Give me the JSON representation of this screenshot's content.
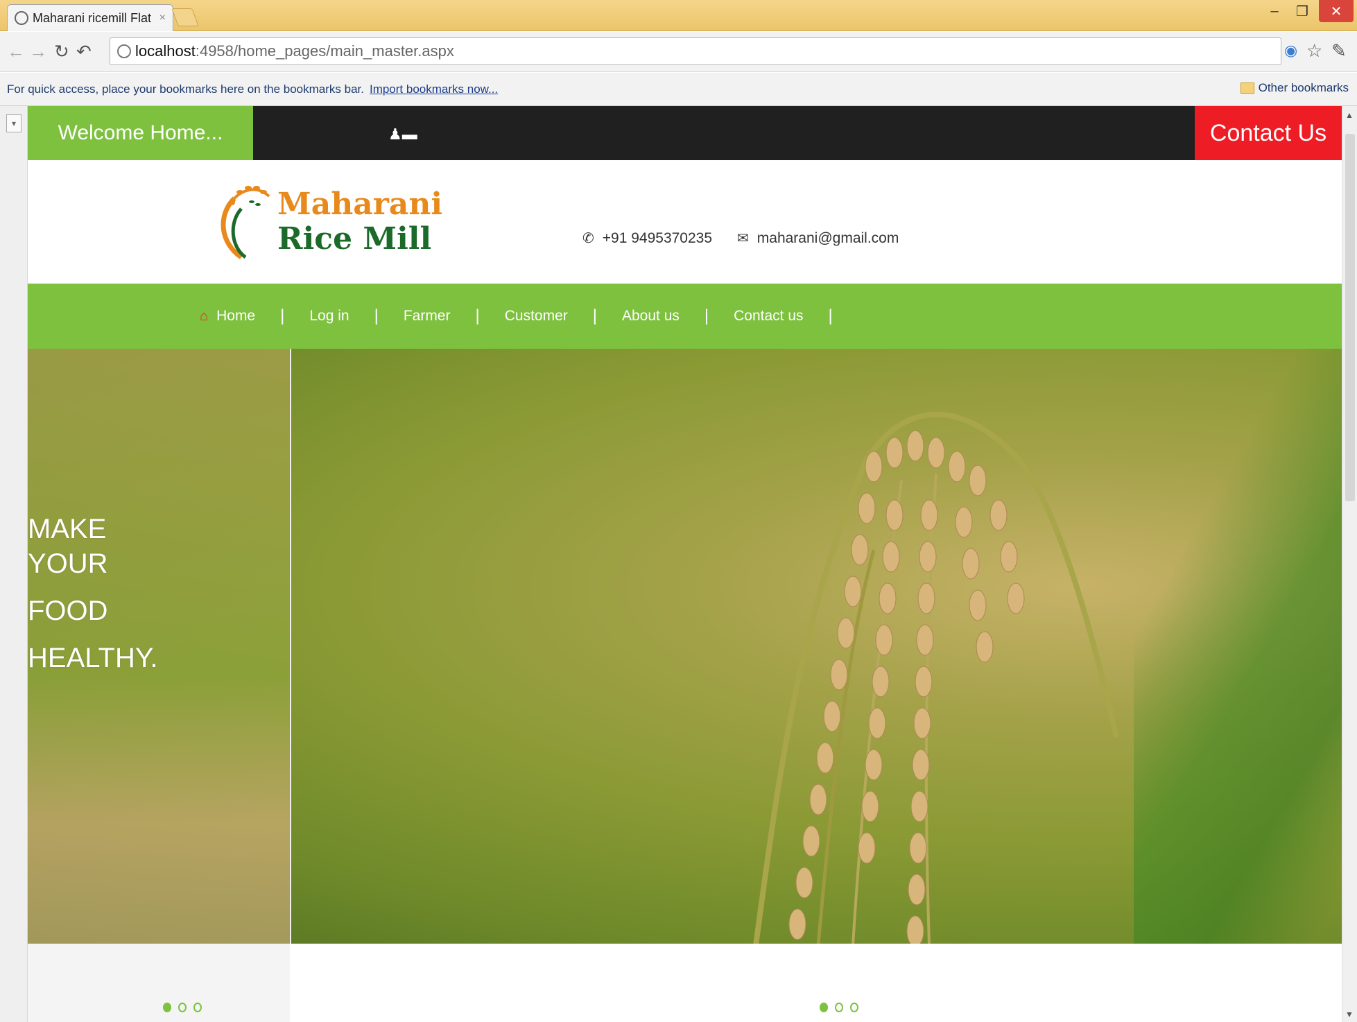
{
  "browser": {
    "tab_title": "Maharani ricemill Flat Boot",
    "tab_close": "×",
    "url_host": "localhost",
    "url_path": ":4958/home_pages/main_master.aspx",
    "bookmarks_message": "For quick access, place your bookmarks here on the bookmarks bar.",
    "import_link": "Import bookmarks now...",
    "other_bookmarks": "Other bookmarks",
    "min_glyph": "–",
    "max_glyph": "❐",
    "close_glyph": "✕"
  },
  "topbar": {
    "welcome": "Welcome Home...",
    "user_icon": "♟▬",
    "contact": "Contact Us"
  },
  "header": {
    "logo_line1": "Maharani",
    "logo_line2": "Rice Mill",
    "phone_icon": "✆",
    "phone": "+91 9495370235",
    "email_icon": "✉",
    "email": "maharani@gmail.com"
  },
  "nav": {
    "home_icon": "⌂",
    "items": [
      "Home",
      "Log in",
      "Farmer",
      "Customer",
      "About us",
      "Contact us"
    ],
    "separator": "|"
  },
  "hero": {
    "line1": "MAKE",
    "line2": "YOUR",
    "line3": "FOOD",
    "line4": "HEALTHY."
  },
  "colors": {
    "green": "#7ec13f",
    "red": "#ee1c24",
    "dark": "#202020"
  }
}
